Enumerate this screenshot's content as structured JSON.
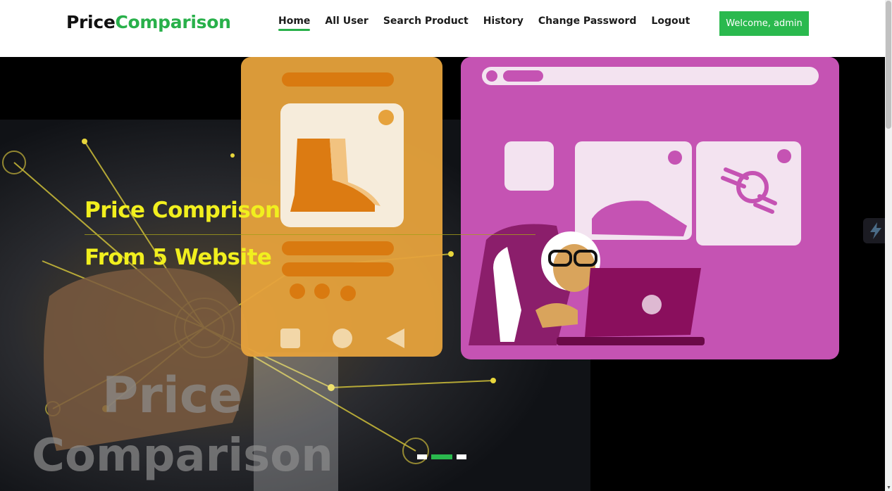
{
  "brand": {
    "part1": "Price",
    "part2": "Comparison"
  },
  "nav": [
    {
      "label": "Home",
      "active": true
    },
    {
      "label": "All User"
    },
    {
      "label": "Search Product"
    },
    {
      "label": "History"
    },
    {
      "label": "Change Password"
    },
    {
      "label": "Logout"
    }
  ],
  "welcome": "Welcome, admin",
  "hero": {
    "line1": "Price Comprison",
    "line2": "From 5 Website",
    "watermark1": "Price",
    "watermark2": "Comparison",
    "slide_count": 3,
    "active_slide": 2
  },
  "colors": {
    "accent": "#2ab94e",
    "headline": "#f1ef1e"
  },
  "icons": {
    "side_widget": "lightning-icon"
  }
}
